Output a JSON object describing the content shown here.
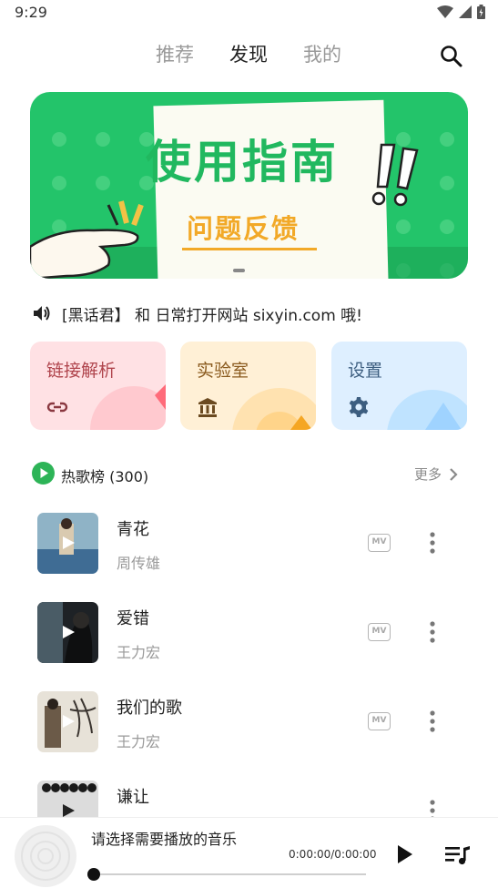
{
  "status_bar": {
    "time": "9:29",
    "icons": [
      "wifi-icon",
      "cellular-signal-icon",
      "battery-icon"
    ]
  },
  "top_nav": {
    "tabs": [
      {
        "label": "推荐",
        "active": false
      },
      {
        "label": "发现",
        "active": true
      },
      {
        "label": "我的",
        "active": false
      }
    ],
    "search_icon": "search-icon"
  },
  "banner": {
    "title": "使用指南",
    "subtitle": "问题反馈"
  },
  "notice": {
    "icon": "speaker-icon",
    "text": "[黑话君】 和 日常打开网站 sixyin.com 哦!"
  },
  "quick_cards": [
    {
      "label": "链接解析",
      "icon": "link-icon",
      "color": "#ffe1e4"
    },
    {
      "label": "实验室",
      "icon": "museum-icon",
      "color": "#fff0d6"
    },
    {
      "label": "设置",
      "icon": "gear-icon",
      "color": "#deefff"
    }
  ],
  "hot_section": {
    "title": "热歌榜 (300)",
    "more": "更多",
    "accent": "#2db457"
  },
  "songs": [
    {
      "title": "青花",
      "artist": "周传雄",
      "mv": "MV"
    },
    {
      "title": "爱错",
      "artist": "王力宏",
      "mv": "MV"
    },
    {
      "title": "我们的歌",
      "artist": "王力宏",
      "mv": "MV"
    },
    {
      "title": "谦让",
      "artist": "",
      "mv": ""
    }
  ],
  "player": {
    "title": "请选择需要播放的音乐",
    "time": "0:00:00/0:00:00",
    "progress": 0
  },
  "colors": {
    "brand_green": "#23c46a",
    "text_primary": "#222222",
    "text_secondary": "#9a9a9a"
  }
}
